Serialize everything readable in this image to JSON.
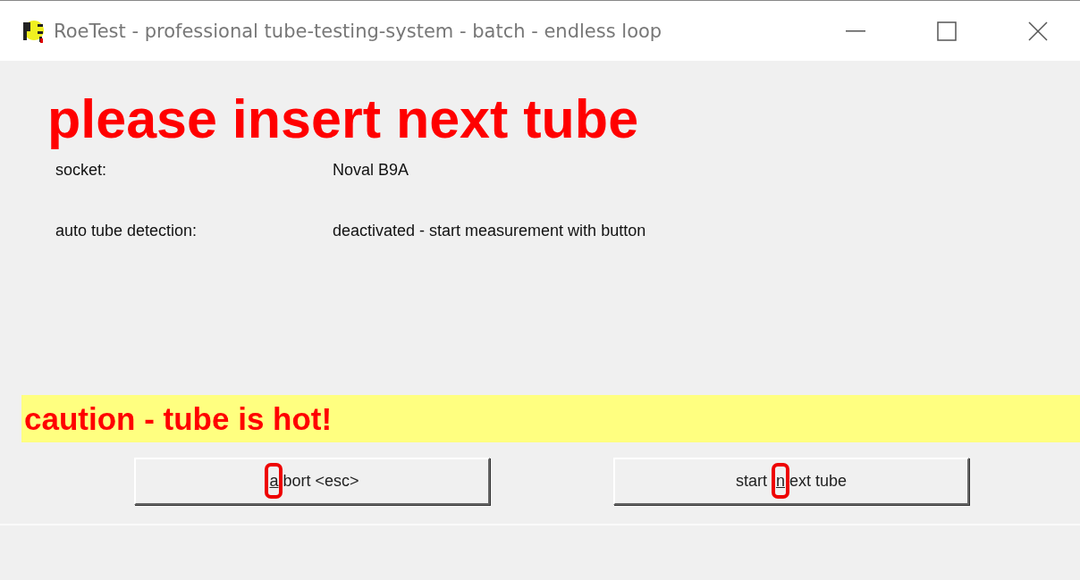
{
  "window": {
    "title": "RoeTest - professional tube-testing-system - batch - endless loop"
  },
  "heading": "please insert next tube",
  "fields": [
    {
      "label": "socket:",
      "value": "Noval B9A"
    },
    {
      "label": "auto tube detection:",
      "value": "deactivated - start measurement with button"
    }
  ],
  "warning": "caution - tube is hot!",
  "buttons": [
    {
      "key": "a",
      "after": "bort <esc>",
      "highlighted": true
    },
    {
      "before": "start ",
      "key": "n",
      "after": "ext tube",
      "highlighted": true
    }
  ]
}
